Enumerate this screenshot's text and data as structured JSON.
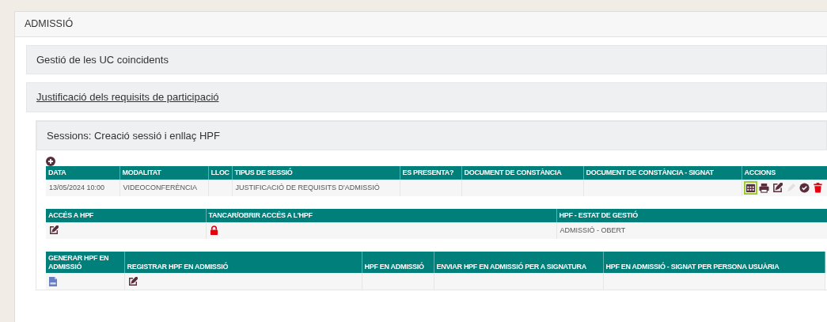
{
  "panel": {
    "title": "ADMISSIÓ"
  },
  "sections": [
    {
      "title": "Gestió de les UC coincidents",
      "kind": "header"
    },
    {
      "title": "Justificació dels requisits de participació",
      "kind": "link"
    }
  ],
  "sessions": {
    "title": "Sessions: Creació sessió i enllaç HPF",
    "table": {
      "columns": [
        "DATA",
        "MODALITAT",
        "LLOC",
        "TIPUS DE SESSIÓ",
        "ES PRESENTA?",
        "DOCUMENT DE CONSTÀNCIA",
        "DOCUMENT DE CONSTÀNCIA - SIGNAT",
        "ACCIONS"
      ],
      "rows": [
        {
          "cells": [
            "13/05/2024 10:00",
            "VIDEOCONFERÈNCIA",
            "",
            "JUSTIFICACIÓ DE REQUISITS D'ADMISSIÓ",
            "",
            "",
            ""
          ],
          "actions": [
            {
              "kind": "calendar",
              "disabled": false,
              "selected": true
            },
            {
              "kind": "print",
              "disabled": false,
              "selected": false
            },
            {
              "kind": "edit",
              "disabled": false,
              "selected": false
            },
            {
              "kind": "pen",
              "disabled": true,
              "selected": false
            },
            {
              "kind": "check",
              "disabled": false,
              "selected": false
            },
            {
              "kind": "trash",
              "disabled": false,
              "selected": false
            }
          ]
        }
      ]
    }
  },
  "access_table": {
    "columns": [
      "ACCÉS A HPF",
      "TANCAR/OBRIR ACCÉS A L'HPF",
      "HPF - ESTAT DE GESTIÓ"
    ],
    "row": {
      "locked": true,
      "status": "ADMISSIÓ - OBERT"
    }
  },
  "hpf_table": {
    "columns": [
      "GENERAR HPF EN ADMISSIÓ",
      "REGISTRAR HPF EN ADMISSIÓ",
      "HPF EN ADMISSIÓ",
      "ENVIAR HPF EN ADMISSIÓ PER A SIGNATURA",
      "HPF EN ADMISSIÓ - SIGNAT PER PERSONA USUÀRIA"
    ]
  }
}
